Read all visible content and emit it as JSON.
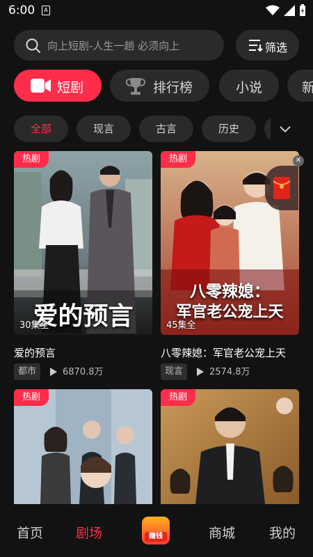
{
  "status": {
    "time": "6:00",
    "sim_label": "A"
  },
  "search": {
    "placeholder": "向上短剧-人生一趟 必须向上",
    "filter_label": "筛选"
  },
  "categories": [
    {
      "label": "短剧",
      "active": true
    },
    {
      "label": "排行榜",
      "active": false
    },
    {
      "label": "小说",
      "active": false
    },
    {
      "label": "新",
      "active": false
    }
  ],
  "subcategories": [
    {
      "label": "全部",
      "active": true
    },
    {
      "label": "现言",
      "active": false
    },
    {
      "label": "古言",
      "active": false
    },
    {
      "label": "历史",
      "active": false
    }
  ],
  "dramas": [
    {
      "badge": "热剧",
      "poster_title": "爱的预言",
      "episodes": "30集全",
      "title": "爱的预言",
      "tag": "都市",
      "views": "6870.8万"
    },
    {
      "badge": "热剧",
      "poster_title_line1": "八零辣媳：",
      "poster_title_line2": "军官老公宠上天",
      "episodes": "45集全",
      "title": "八零辣媳：军官老公宠上天",
      "tag": "现言",
      "views": "2574.8万"
    },
    {
      "badge": "热剧"
    },
    {
      "badge": "热剧"
    }
  ],
  "nav": {
    "home": "首页",
    "theater": "剧场",
    "earn": "赚钱",
    "mall": "商城",
    "me": "我的"
  },
  "colors": {
    "accent": "#ff2d4a",
    "background": "#121212",
    "surface": "#2a2a2a"
  }
}
